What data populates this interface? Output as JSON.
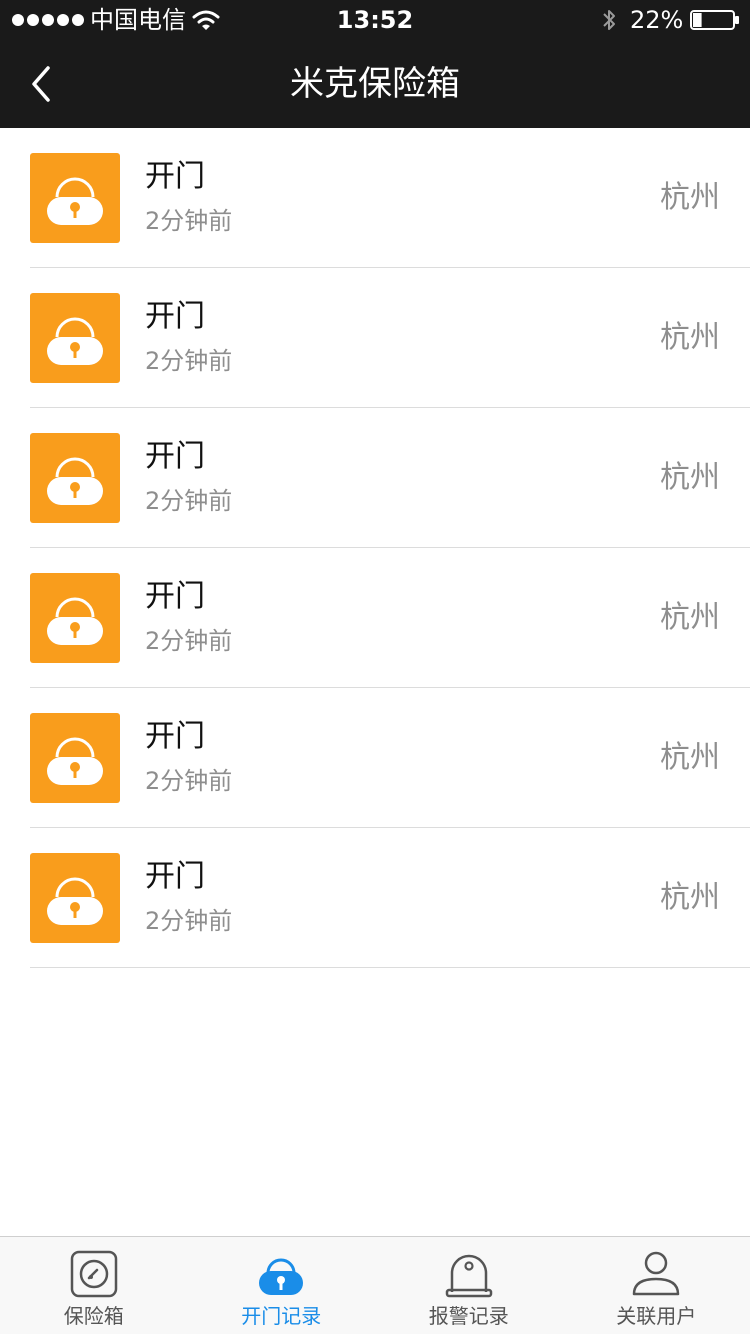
{
  "status_bar": {
    "carrier": "中国电信",
    "time": "13:52",
    "battery": "22%",
    "battery_level": 0.22,
    "signal_bars": 5
  },
  "nav": {
    "title": "米克保险箱",
    "back_icon": "chevron-left-icon"
  },
  "records": [
    {
      "action": "开门",
      "time_ago": "2分钟前",
      "location": "杭州",
      "icon": "lock-icon"
    },
    {
      "action": "开门",
      "time_ago": "2分钟前",
      "location": "杭州",
      "icon": "lock-icon"
    },
    {
      "action": "开门",
      "time_ago": "2分钟前",
      "location": "杭州",
      "icon": "lock-icon"
    },
    {
      "action": "开门",
      "time_ago": "2分钟前",
      "location": "杭州",
      "icon": "lock-icon"
    },
    {
      "action": "开门",
      "time_ago": "2分钟前",
      "location": "杭州",
      "icon": "lock-icon"
    },
    {
      "action": "开门",
      "time_ago": "2分钟前",
      "location": "杭州",
      "icon": "lock-icon"
    }
  ],
  "tabs": [
    {
      "label": "保险箱",
      "icon": "safe-dial-icon",
      "active": false
    },
    {
      "label": "开门记录",
      "icon": "lock-icon",
      "active": true
    },
    {
      "label": "报警记录",
      "icon": "alarm-bell-icon",
      "active": false
    },
    {
      "label": "关联用户",
      "icon": "user-icon",
      "active": false
    }
  ],
  "colors": {
    "header_bg": "#1a1a1a",
    "lock_tile": "#f99d1c",
    "tab_active": "#1a8de8",
    "secondary_text": "#8e8e8e"
  }
}
